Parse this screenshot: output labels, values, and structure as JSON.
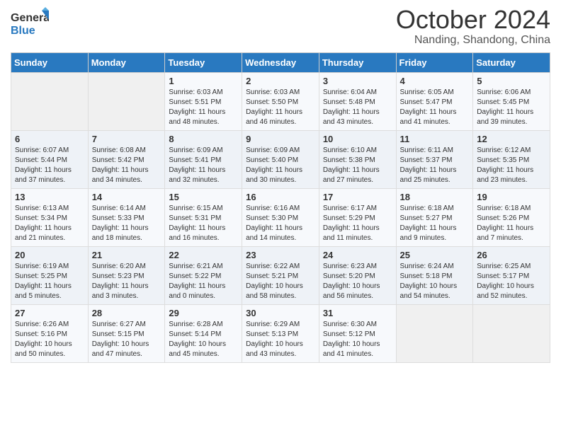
{
  "logo": {
    "line1": "General",
    "line2": "Blue"
  },
  "title": "October 2024",
  "location": "Nanding, Shandong, China",
  "days_of_week": [
    "Sunday",
    "Monday",
    "Tuesday",
    "Wednesday",
    "Thursday",
    "Friday",
    "Saturday"
  ],
  "weeks": [
    [
      {
        "day": "",
        "sunrise": "",
        "sunset": "",
        "daylight": ""
      },
      {
        "day": "",
        "sunrise": "",
        "sunset": "",
        "daylight": ""
      },
      {
        "day": "1",
        "sunrise": "Sunrise: 6:03 AM",
        "sunset": "Sunset: 5:51 PM",
        "daylight": "Daylight: 11 hours and 48 minutes."
      },
      {
        "day": "2",
        "sunrise": "Sunrise: 6:03 AM",
        "sunset": "Sunset: 5:50 PM",
        "daylight": "Daylight: 11 hours and 46 minutes."
      },
      {
        "day": "3",
        "sunrise": "Sunrise: 6:04 AM",
        "sunset": "Sunset: 5:48 PM",
        "daylight": "Daylight: 11 hours and 43 minutes."
      },
      {
        "day": "4",
        "sunrise": "Sunrise: 6:05 AM",
        "sunset": "Sunset: 5:47 PM",
        "daylight": "Daylight: 11 hours and 41 minutes."
      },
      {
        "day": "5",
        "sunrise": "Sunrise: 6:06 AM",
        "sunset": "Sunset: 5:45 PM",
        "daylight": "Daylight: 11 hours and 39 minutes."
      }
    ],
    [
      {
        "day": "6",
        "sunrise": "Sunrise: 6:07 AM",
        "sunset": "Sunset: 5:44 PM",
        "daylight": "Daylight: 11 hours and 37 minutes."
      },
      {
        "day": "7",
        "sunrise": "Sunrise: 6:08 AM",
        "sunset": "Sunset: 5:42 PM",
        "daylight": "Daylight: 11 hours and 34 minutes."
      },
      {
        "day": "8",
        "sunrise": "Sunrise: 6:09 AM",
        "sunset": "Sunset: 5:41 PM",
        "daylight": "Daylight: 11 hours and 32 minutes."
      },
      {
        "day": "9",
        "sunrise": "Sunrise: 6:09 AM",
        "sunset": "Sunset: 5:40 PM",
        "daylight": "Daylight: 11 hours and 30 minutes."
      },
      {
        "day": "10",
        "sunrise": "Sunrise: 6:10 AM",
        "sunset": "Sunset: 5:38 PM",
        "daylight": "Daylight: 11 hours and 27 minutes."
      },
      {
        "day": "11",
        "sunrise": "Sunrise: 6:11 AM",
        "sunset": "Sunset: 5:37 PM",
        "daylight": "Daylight: 11 hours and 25 minutes."
      },
      {
        "day": "12",
        "sunrise": "Sunrise: 6:12 AM",
        "sunset": "Sunset: 5:35 PM",
        "daylight": "Daylight: 11 hours and 23 minutes."
      }
    ],
    [
      {
        "day": "13",
        "sunrise": "Sunrise: 6:13 AM",
        "sunset": "Sunset: 5:34 PM",
        "daylight": "Daylight: 11 hours and 21 minutes."
      },
      {
        "day": "14",
        "sunrise": "Sunrise: 6:14 AM",
        "sunset": "Sunset: 5:33 PM",
        "daylight": "Daylight: 11 hours and 18 minutes."
      },
      {
        "day": "15",
        "sunrise": "Sunrise: 6:15 AM",
        "sunset": "Sunset: 5:31 PM",
        "daylight": "Daylight: 11 hours and 16 minutes."
      },
      {
        "day": "16",
        "sunrise": "Sunrise: 6:16 AM",
        "sunset": "Sunset: 5:30 PM",
        "daylight": "Daylight: 11 hours and 14 minutes."
      },
      {
        "day": "17",
        "sunrise": "Sunrise: 6:17 AM",
        "sunset": "Sunset: 5:29 PM",
        "daylight": "Daylight: 11 hours and 11 minutes."
      },
      {
        "day": "18",
        "sunrise": "Sunrise: 6:18 AM",
        "sunset": "Sunset: 5:27 PM",
        "daylight": "Daylight: 11 hours and 9 minutes."
      },
      {
        "day": "19",
        "sunrise": "Sunrise: 6:18 AM",
        "sunset": "Sunset: 5:26 PM",
        "daylight": "Daylight: 11 hours and 7 minutes."
      }
    ],
    [
      {
        "day": "20",
        "sunrise": "Sunrise: 6:19 AM",
        "sunset": "Sunset: 5:25 PM",
        "daylight": "Daylight: 11 hours and 5 minutes."
      },
      {
        "day": "21",
        "sunrise": "Sunrise: 6:20 AM",
        "sunset": "Sunset: 5:23 PM",
        "daylight": "Daylight: 11 hours and 3 minutes."
      },
      {
        "day": "22",
        "sunrise": "Sunrise: 6:21 AM",
        "sunset": "Sunset: 5:22 PM",
        "daylight": "Daylight: 11 hours and 0 minutes."
      },
      {
        "day": "23",
        "sunrise": "Sunrise: 6:22 AM",
        "sunset": "Sunset: 5:21 PM",
        "daylight": "Daylight: 10 hours and 58 minutes."
      },
      {
        "day": "24",
        "sunrise": "Sunrise: 6:23 AM",
        "sunset": "Sunset: 5:20 PM",
        "daylight": "Daylight: 10 hours and 56 minutes."
      },
      {
        "day": "25",
        "sunrise": "Sunrise: 6:24 AM",
        "sunset": "Sunset: 5:18 PM",
        "daylight": "Daylight: 10 hours and 54 minutes."
      },
      {
        "day": "26",
        "sunrise": "Sunrise: 6:25 AM",
        "sunset": "Sunset: 5:17 PM",
        "daylight": "Daylight: 10 hours and 52 minutes."
      }
    ],
    [
      {
        "day": "27",
        "sunrise": "Sunrise: 6:26 AM",
        "sunset": "Sunset: 5:16 PM",
        "daylight": "Daylight: 10 hours and 50 minutes."
      },
      {
        "day": "28",
        "sunrise": "Sunrise: 6:27 AM",
        "sunset": "Sunset: 5:15 PM",
        "daylight": "Daylight: 10 hours and 47 minutes."
      },
      {
        "day": "29",
        "sunrise": "Sunrise: 6:28 AM",
        "sunset": "Sunset: 5:14 PM",
        "daylight": "Daylight: 10 hours and 45 minutes."
      },
      {
        "day": "30",
        "sunrise": "Sunrise: 6:29 AM",
        "sunset": "Sunset: 5:13 PM",
        "daylight": "Daylight: 10 hours and 43 minutes."
      },
      {
        "day": "31",
        "sunrise": "Sunrise: 6:30 AM",
        "sunset": "Sunset: 5:12 PM",
        "daylight": "Daylight: 10 hours and 41 minutes."
      },
      {
        "day": "",
        "sunrise": "",
        "sunset": "",
        "daylight": ""
      },
      {
        "day": "",
        "sunrise": "",
        "sunset": "",
        "daylight": ""
      }
    ]
  ]
}
